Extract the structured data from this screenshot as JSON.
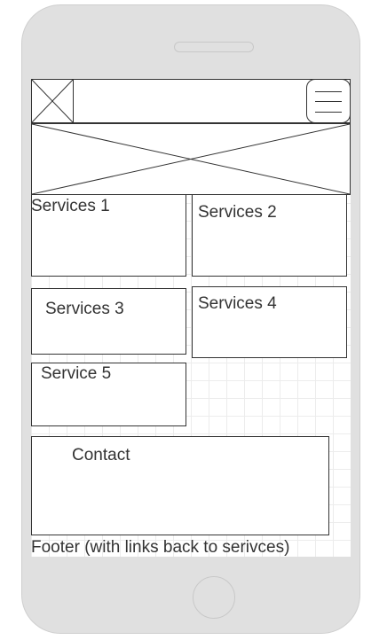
{
  "header": {
    "logo_icon": "image-placeholder-icon",
    "menu_icon": "hamburger-menu-icon"
  },
  "hero": {
    "icon": "image-placeholder-icon"
  },
  "services": [
    {
      "label": "Services 1"
    },
    {
      "label": "Services 2"
    },
    {
      "label": "Services 3"
    },
    {
      "label": "Services 4"
    },
    {
      "label": "Service 5"
    }
  ],
  "contact": {
    "label": "Contact"
  },
  "footer": {
    "text": "Footer (with links back to serivces)"
  }
}
